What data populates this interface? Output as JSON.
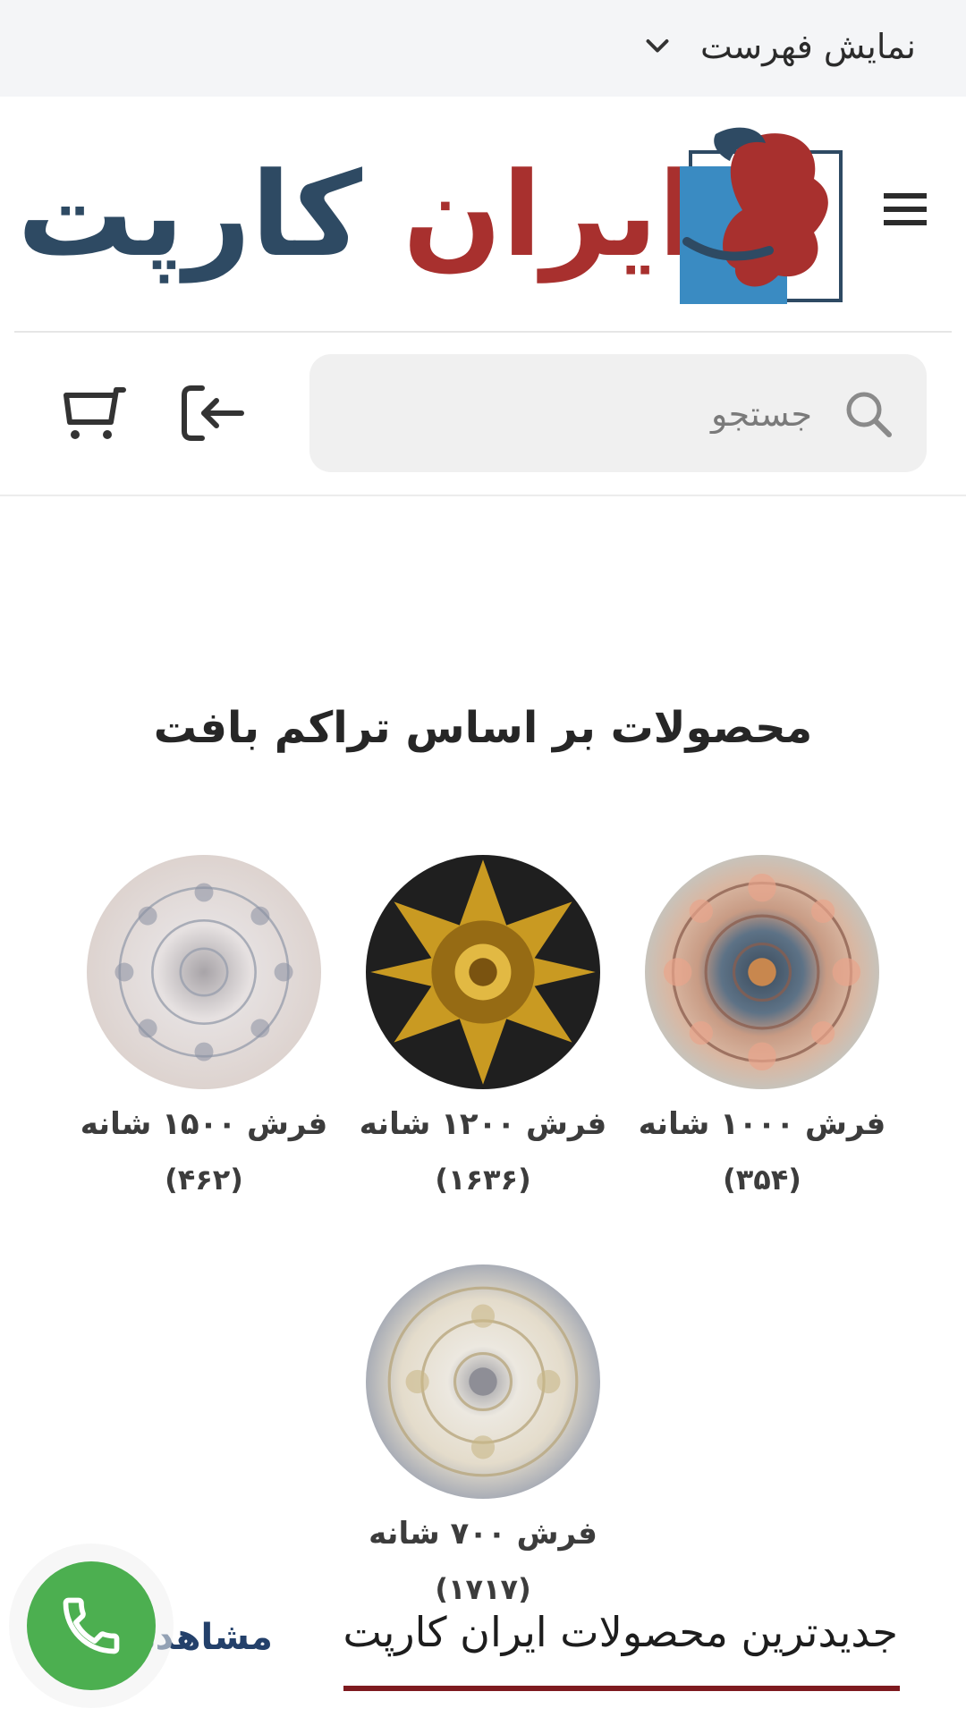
{
  "topbar": {
    "toggle_label": "نمایش فهرست",
    "icon": "chevron-down-icon"
  },
  "header": {
    "logo_text_part1": "ایران",
    "logo_text_part2": "کارپت",
    "logo_colors": {
      "red": "#a8302e",
      "navy": "#2e4a63",
      "blue": "#3a8bc2"
    },
    "menu_icon": "hamburger-icon"
  },
  "search": {
    "placeholder": "جستجو",
    "value": "",
    "icon": "search-icon"
  },
  "actions": {
    "login_icon": "login-icon",
    "cart_icon": "cart-icon"
  },
  "section": {
    "title": "محصولات بر اساس تراکم بافت",
    "categories": [
      {
        "name": "فرش ۱۰۰۰ شانه",
        "count": "(۳۵۴)",
        "style": "peach-medallion"
      },
      {
        "name": "فرش ۱۲۰۰ شانه",
        "count": "(۱۶۳۶)",
        "style": "black-gold-medallion"
      },
      {
        "name": "فرش ۱۵۰۰ شانه",
        "count": "(۴۶۲)",
        "style": "cream-medallion"
      },
      {
        "name": "فرش ۷۰۰ شانه",
        "count": "(۱۷۱۷)",
        "style": "grey-cream-medallion"
      }
    ]
  },
  "latest": {
    "title": "جدیدترین محصولات ایران کارپت",
    "view_all": "مشاهده",
    "accent_color": "#7e1a1f"
  },
  "fab": {
    "icon": "phone-icon",
    "color": "#4caf50"
  }
}
